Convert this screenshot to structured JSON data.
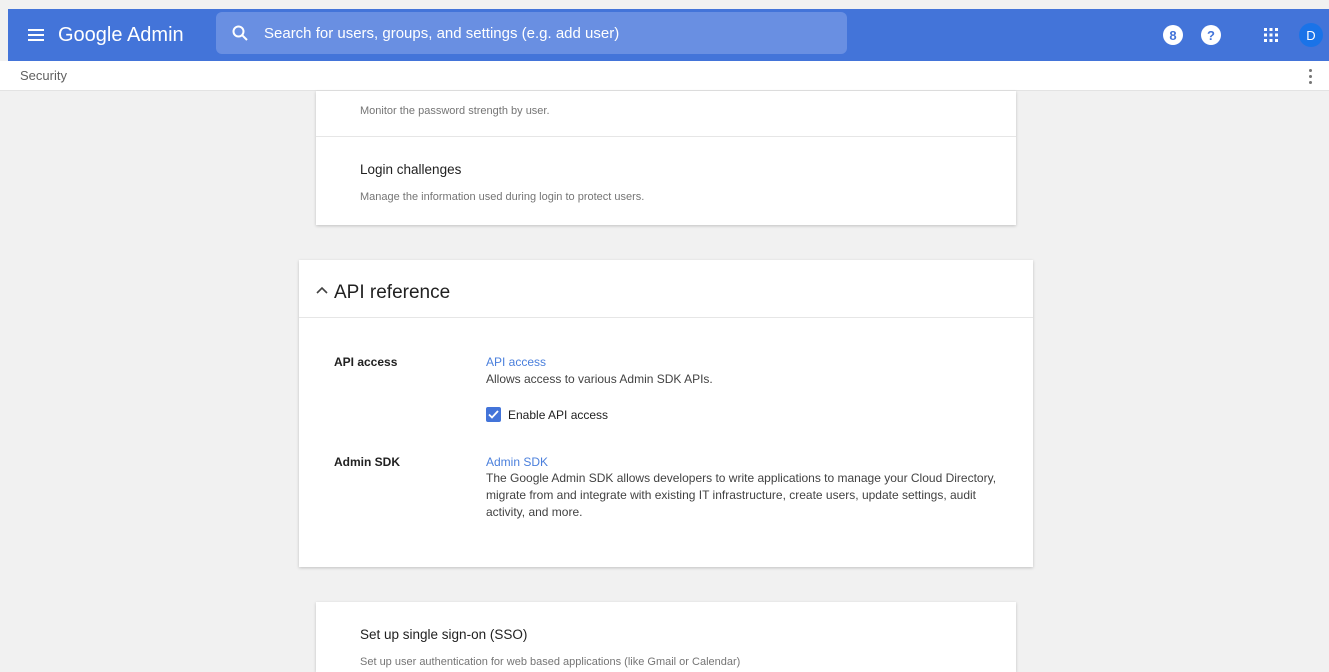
{
  "app": {
    "title": "Google Admin"
  },
  "search": {
    "placeholder": "Search for users, groups, and settings (e.g. add user)"
  },
  "topbar": {
    "badge_icon": "8",
    "help_icon": "?",
    "avatar_letter": "D",
    "accent": "#4374d9"
  },
  "breadcrumb": {
    "label": "Security"
  },
  "top_card": {
    "row1_desc": "Monitor the password strength by user.",
    "row2_title": "Login challenges",
    "row2_desc": "Manage the information used during login to protect users."
  },
  "api_reference": {
    "title": "API reference",
    "api_access": {
      "label": "API access",
      "link": "API access",
      "description": "Allows access to various Admin SDK APIs.",
      "checkbox_label": "Enable API access",
      "checked": true
    },
    "admin_sdk": {
      "label": "Admin SDK",
      "link": "Admin SDK",
      "description": "The Google Admin SDK allows developers to write applications to manage your Cloud Directory, migrate from and integrate with existing IT infrastructure, create users, update settings, audit activity, and more."
    }
  },
  "sso_card": {
    "title": "Set up single sign-on (SSO)",
    "description": "Set up user authentication for web based applications (like Gmail or Calendar)"
  }
}
